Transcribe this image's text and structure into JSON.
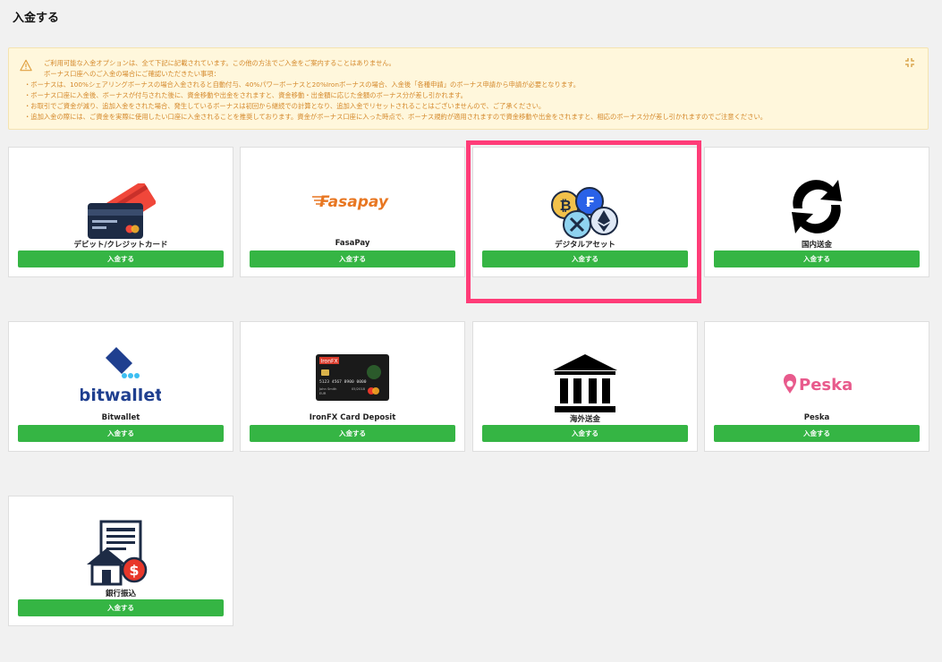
{
  "page": {
    "title": "入金する"
  },
  "notice": {
    "lines": [
      "ご利用可能な入金オプションは、全て下記に記載されています。この他の方法でご入金をご案内することはありません。",
      "ボーナス口座へのご入金の場合にご確認いただきたい事項：",
      "・ボーナスは、100%シェアリングボーナスの場合入金されると自動付与、40%パワーボーナスと20%Ironボーナスの場合、入金後「各種申請」のボーナス申請から申請が必要となります。",
      "・ボーナス口座に入金後、ボーナスが付与された後に、資金移動や出金をされますと、資金移動・出金額に応じた金額のボーナス分が差し引かれます。",
      "・お取引でご資金が減り、追加入金をされた場合、発生しているボーナスは初回から継続での計算となり、追加入金でリセットされることはございませんので、ご了承ください。",
      "・追加入金の際には、ご資金を実際に使用したい口座に入金されることを推奨しております。資金がボーナス口座に入った時点で、ボーナス規約が適用されますので資金移動や出金をされますと、相応のボーナス分が差し引かれますのでご注意ください。"
    ]
  },
  "methods": [
    {
      "label": "デビット/クレジットカード",
      "button": "入金する",
      "icon": "credit-card-icon"
    },
    {
      "label": "FasaPay",
      "button": "入金する",
      "icon": "fasapay-logo"
    },
    {
      "label": "デジタルアセット",
      "button": "入金する",
      "icon": "crypto-coins-icon"
    },
    {
      "label": "国内送金",
      "button": "入金する",
      "icon": "transfer-arrows-icon"
    },
    {
      "label": "Bitwallet",
      "button": "入金する",
      "icon": "bitwallet-logo"
    },
    {
      "label": "IronFX Card Deposit",
      "button": "入金する",
      "icon": "ironfx-card-icon"
    },
    {
      "label": "海外送金",
      "button": "入金する",
      "icon": "bank-icon"
    },
    {
      "label": "Peska",
      "button": "入金する",
      "icon": "peska-logo"
    },
    {
      "label": "銀行振込",
      "button": "入金する",
      "icon": "bank-transfer-document-icon"
    }
  ],
  "logos": {
    "fasapay": "Fasapay",
    "bitwallet": "bitwallet",
    "peska": "Peska",
    "ironfx_card": {
      "brand": "IronFX",
      "number": "5123 4567 8900 0000",
      "name": "John Smith",
      "currency": "EUR",
      "expiry": "05/2018"
    }
  },
  "colors": {
    "accent_button": "#35b544",
    "notice_bg": "#fff7dc",
    "notice_text": "#d4882a",
    "highlight": "#ff3c78"
  }
}
